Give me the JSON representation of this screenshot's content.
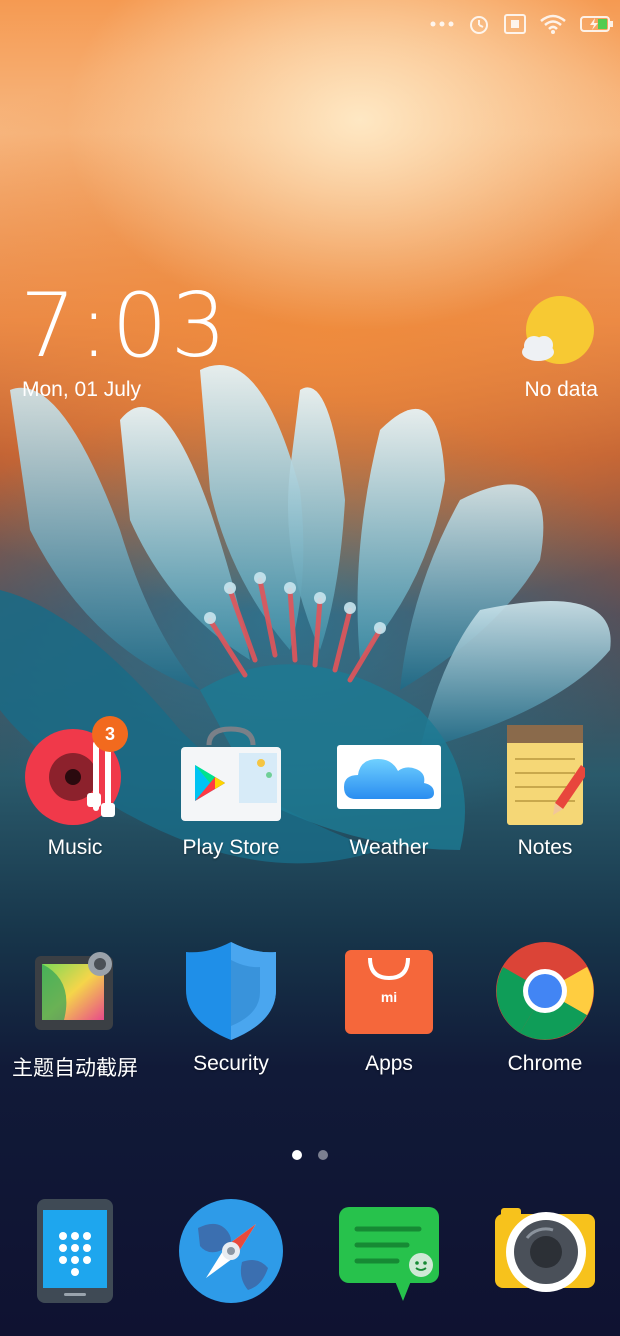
{
  "status_bar": {
    "icons": [
      "dots-icon",
      "alarm-icon",
      "sim-icon",
      "wifi-icon",
      "battery-charging-icon"
    ]
  },
  "clock": {
    "time": "7:03",
    "date": "Mon, 01 July"
  },
  "weather_widget": {
    "text": "No data",
    "icon": "sun-cloud-icon"
  },
  "home_apps": [
    {
      "label": "Music",
      "icon": "music-icon",
      "badge": "3"
    },
    {
      "label": "Play Store",
      "icon": "play-store-icon"
    },
    {
      "label": "Weather",
      "icon": "weather-cloud-icon"
    },
    {
      "label": "Notes",
      "icon": "notes-icon"
    },
    {
      "label": "主题自动截屏",
      "icon": "theme-screenshot-icon"
    },
    {
      "label": "Security",
      "icon": "security-shield-icon"
    },
    {
      "label": "Apps",
      "icon": "mi-apps-bag-icon"
    },
    {
      "label": "Chrome",
      "icon": "chrome-icon"
    }
  ],
  "page_indicator": {
    "pages": 2,
    "current": 1
  },
  "dock": [
    {
      "icon": "phone-dialer-icon"
    },
    {
      "icon": "browser-compass-icon"
    },
    {
      "icon": "messaging-icon"
    },
    {
      "icon": "camera-icon"
    }
  ],
  "colors": {
    "badge": "#f26a1e",
    "music": "#f0394a",
    "messaging": "#27c24c",
    "camera": "#f7c21c"
  }
}
